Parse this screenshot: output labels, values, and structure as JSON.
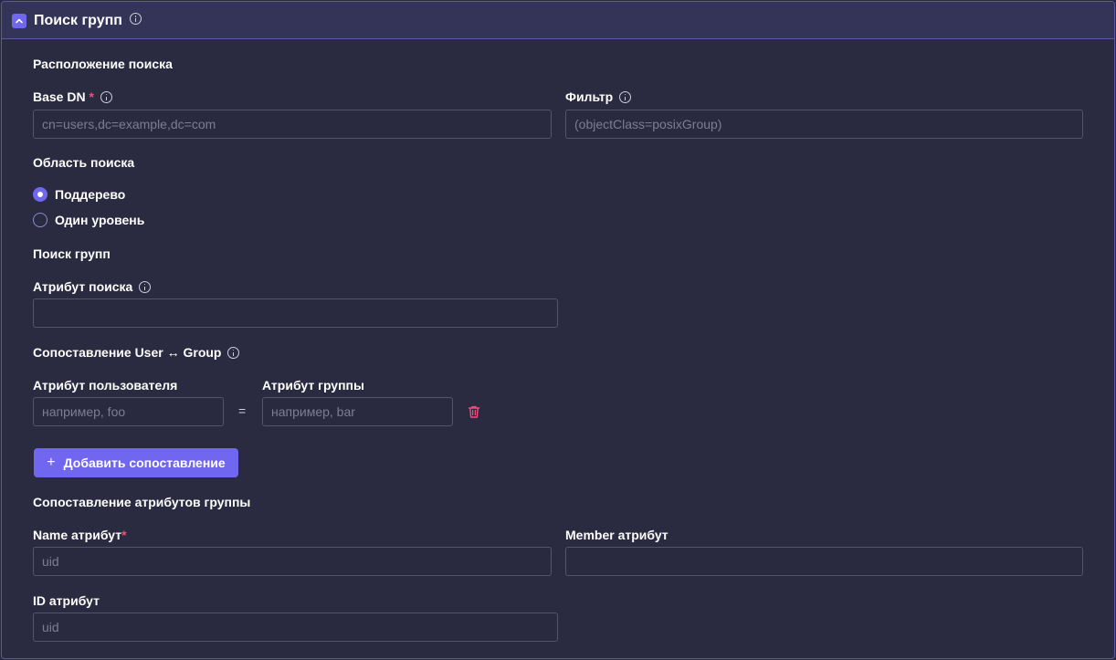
{
  "header": {
    "title": "Поиск групп"
  },
  "location": {
    "title": "Расположение поиска",
    "base_dn": {
      "label": "Base DN",
      "required_mark": "*",
      "placeholder": "cn=users,dc=example,dc=com",
      "value": ""
    },
    "filter": {
      "label": "Фильтр",
      "placeholder": "(objectClass=posixGroup)",
      "value": ""
    }
  },
  "scope": {
    "title": "Область поиска",
    "options": [
      {
        "label": "Поддерево",
        "checked": true
      },
      {
        "label": "Один уровень",
        "checked": false
      }
    ]
  },
  "group_search": {
    "title": "Поиск групп",
    "search_attribute": {
      "label": "Атрибут поиска",
      "value": ""
    }
  },
  "mapping": {
    "title": "Сопоставление User ↔ Group",
    "user_attr_label": "Атрибут пользователя",
    "group_attr_label": "Атрибут группы",
    "rows": [
      {
        "user_placeholder": "например, foo",
        "group_placeholder": "например, bar",
        "equals": "="
      }
    ],
    "add_button_plus": "+",
    "add_button_label": "Добавить сопоставление"
  },
  "group_attrs": {
    "title": "Сопоставление атрибутов группы",
    "name_attr": {
      "label": "Name атрибут",
      "required_mark": "*",
      "placeholder": "uid"
    },
    "member_attr": {
      "label": "Member атрибут",
      "placeholder": ""
    },
    "id_attr": {
      "label": "ID атрибут",
      "placeholder": "uid"
    }
  },
  "colors": {
    "accent": "#7166f0",
    "danger": "#ef4f7d",
    "background": "#2a2a40",
    "header_background": "#343459",
    "border": "#5c5a9c"
  }
}
